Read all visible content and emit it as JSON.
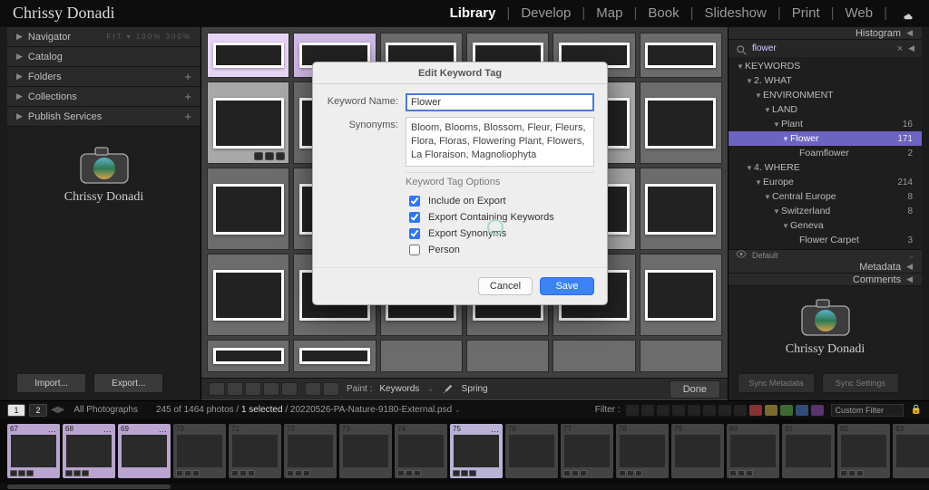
{
  "logo": "Chrissy Donadi",
  "modules": {
    "items": [
      "Library",
      "Develop",
      "Map",
      "Book",
      "Slideshow",
      "Print",
      "Web"
    ],
    "active": "Library"
  },
  "left_panel": {
    "navigator": "Navigator",
    "nav_nums": "FIT ▾   100%   300%",
    "catalog": "Catalog",
    "folders": "Folders",
    "collections": "Collections",
    "publish": "Publish Services",
    "import": "Import...",
    "export": "Export..."
  },
  "right_panel": {
    "histogram": "Histogram",
    "search_value": "flower",
    "tree": {
      "root": "KEYWORDS",
      "what": "2. WHAT",
      "env": "ENVIRONMENT",
      "land": "LAND",
      "plant": {
        "label": "Plant",
        "count": "16"
      },
      "flower": {
        "label": "Flower",
        "count": "171"
      },
      "foam": {
        "label": "Foamflower",
        "count": "2"
      },
      "where": "4. WHERE",
      "europe": {
        "label": "Europe",
        "count": "214"
      },
      "ceurope": {
        "label": "Central Europe",
        "count": "8"
      },
      "switz": {
        "label": "Switzerland",
        "count": "8"
      },
      "geneva": "Geneva",
      "carpet": {
        "label": "Flower Carpet",
        "count": "3"
      }
    },
    "default": "Default",
    "metadata": "Metadata",
    "comments": "Comments",
    "sync_metadata": "Sync Metadata",
    "sync_settings": "Sync Settings"
  },
  "toolbar": {
    "paint_label": "Paint :",
    "paint_mode": "Keywords",
    "paint_value": "Spring",
    "done": "Done"
  },
  "footer": {
    "page_a": "1",
    "page_b": "2",
    "source": "All Photographs",
    "count": "245 of 1464 photos / ",
    "selected": "1 selected",
    "path": " / 20220526-PA-Nature-9180-External.psd",
    "filter_label": "Filter :",
    "custom_filter": "Custom Filter"
  },
  "dialog": {
    "title": "Edit Keyword Tag",
    "name_label": "Keyword Name:",
    "name_value": "Flower",
    "syn_label": "Synonyms:",
    "syn_value": "Bloom, Blooms, Blossom, Fleur, Fleurs, Flora, Floras, Flowering Plant, Flowers, La Floraison, Magnoliophyta",
    "opts_head": "Keyword Tag Options",
    "opt1": "Include on Export",
    "opt2": "Export Containing Keywords",
    "opt3": "Export Synonyms",
    "opt4": "Person",
    "cancel": "Cancel",
    "save": "Save"
  },
  "film": {
    "nums": [
      "67",
      "68",
      "69",
      "70",
      "71",
      "72",
      "73",
      "74",
      "75",
      "76",
      "77",
      "78",
      "79",
      "80",
      "81",
      "82",
      "83"
    ]
  }
}
